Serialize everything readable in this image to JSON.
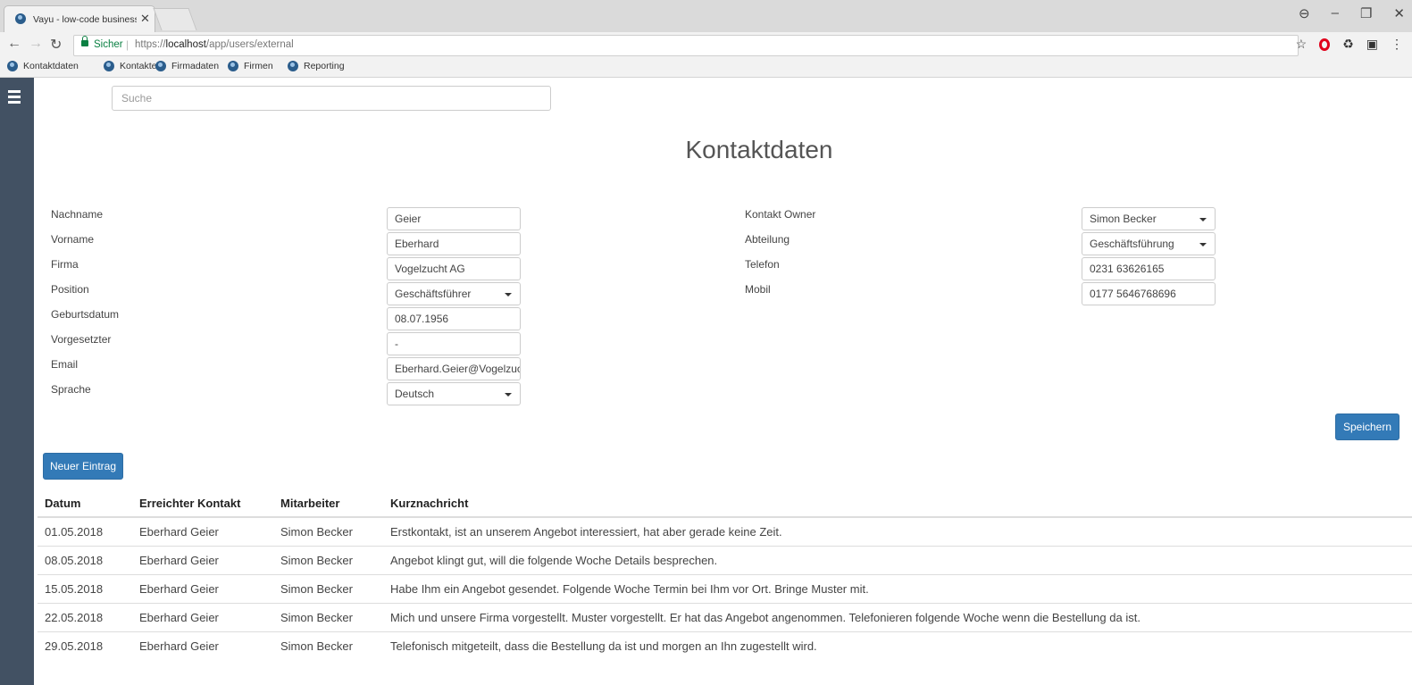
{
  "browser": {
    "tab_title": "Vayu - low-code business",
    "secure_label": "Sicher",
    "url_prefix": "https://",
    "url_host": "localhost",
    "url_path": "/app/users/external",
    "bookmarks": [
      "Kontaktdaten",
      "Kontakte",
      "Firmadaten",
      "Firmen",
      "Reporting"
    ]
  },
  "search": {
    "placeholder": "Suche"
  },
  "page": {
    "title": "Kontaktdaten"
  },
  "form": {
    "left": [
      {
        "label": "Nachname",
        "value": "Geier",
        "type": "text"
      },
      {
        "label": "Vorname",
        "value": "Eberhard",
        "type": "text"
      },
      {
        "label": "Firma",
        "value": "Vogelzucht AG",
        "type": "text"
      },
      {
        "label": "Position",
        "value": "Geschäftsführer",
        "type": "select"
      },
      {
        "label": "Geburtsdatum",
        "value": "08.07.1956",
        "type": "text"
      },
      {
        "label": "Vorgesetzter",
        "value": "-",
        "type": "text"
      },
      {
        "label": "Email",
        "value": "Eberhard.Geier@Vogelzuc",
        "type": "text"
      },
      {
        "label": "Sprache",
        "value": "Deutsch",
        "type": "select"
      }
    ],
    "right": [
      {
        "label": "Kontakt Owner",
        "value": "Simon Becker",
        "type": "select"
      },
      {
        "label": "Abteilung",
        "value": "Geschäftsführung",
        "type": "select"
      },
      {
        "label": "Telefon",
        "value": "0231 63626165",
        "type": "text"
      },
      {
        "label": "Mobil",
        "value": "0177 5646768696",
        "type": "text"
      }
    ],
    "save_label": "Speichern"
  },
  "log": {
    "new_entry_label": "Neuer Eintrag",
    "columns": [
      "Datum",
      "Erreichter Kontakt",
      "Mitarbeiter",
      "Kurznachricht"
    ],
    "rows": [
      [
        "01.05.2018",
        "Eberhard Geier",
        "Simon Becker",
        "Erstkontakt, ist an unserem Angebot interessiert, hat aber gerade keine Zeit."
      ],
      [
        "08.05.2018",
        "Eberhard Geier",
        "Simon Becker",
        "Angebot klingt gut, will die folgende Woche Details besprechen."
      ],
      [
        "15.05.2018",
        "Eberhard Geier",
        "Simon Becker",
        "Habe Ihm ein Angebot gesendet. Folgende Woche Termin bei Ihm vor Ort. Bringe Muster mit."
      ],
      [
        "22.05.2018",
        "Eberhard Geier",
        "Simon Becker",
        "Mich und unsere Firma vorgestellt. Muster vorgestellt. Er hat das Angebot angenommen. Telefonieren folgende Woche wenn die Bestellung da ist."
      ],
      [
        "29.05.2018",
        "Eberhard Geier",
        "Simon Becker",
        "Telefonisch mitgeteilt, dass die Bestellung da ist und morgen an Ihn zugestellt wird."
      ]
    ]
  },
  "colors": {
    "primary": "#337ab7",
    "sidebar": "#425163"
  },
  "icons": [
    "menu-icon",
    "favicon-icon",
    "back-icon",
    "forward-icon",
    "reload-icon",
    "lock-icon",
    "star-icon",
    "opera-icon",
    "profile-icon",
    "chevron-down-icon"
  ]
}
